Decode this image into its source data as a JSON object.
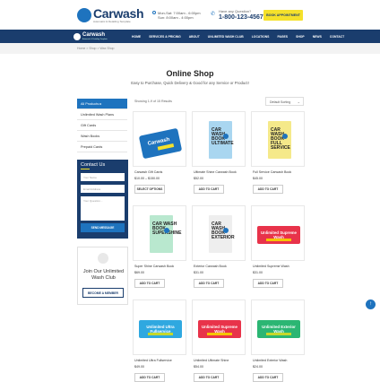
{
  "header": {
    "logo_word": "Carwash",
    "logo_tagline": "Automatic & Detailing Template",
    "hours_line1": "Mon-Sat: 7:00am - 6:00pm",
    "hours_line2": "Sun: 8:00am - 4:00pm",
    "phone_label": "Have any Question?",
    "phone": "1-800-123-4567",
    "book_button": "BOOK APPOINTMENT"
  },
  "nav": {
    "logo_word": "Carwash",
    "logo_tagline": "Automatic & Detailing Template",
    "items": [
      "HOME",
      "SERVICES & PRICING",
      "ABOUT",
      "UNLIMITED WASH CLUB",
      "LOCATIONS",
      "PAGES",
      "SHOP",
      "NEWS",
      "CONTACT"
    ]
  },
  "breadcrumb": "Home  >  Shop  >  Wax Shop",
  "page": {
    "title": "Online Shop",
    "subtitle": "Easy to Purchase, Quick Delivery & Good for any Service or Product!"
  },
  "sidebar": {
    "categories": [
      "All Products",
      "Unlimited Wash Plans",
      "Gift Cards",
      "Wash Books",
      "Prepaid Cards"
    ]
  },
  "contact": {
    "title": "Contact Us",
    "name_placeholder": "Your Name",
    "email_placeholder": "Email Address",
    "question_placeholder": "Your Question...",
    "send": "SEND MESSAGE"
  },
  "club": {
    "text": "Join Our Unlimited Wash Club",
    "button": "BECOME A MEMBER"
  },
  "shop": {
    "showing": "Showing 1-9 of 15 Results",
    "sort": "Default Sorting"
  },
  "products": [
    {
      "name": "Carwash Gift Cards",
      "price": "$10.00 – $150.00",
      "button": "SELECT OPTIONS",
      "kind": "gift",
      "card_text": "Carwash"
    },
    {
      "name": "Ultimate Shine Carwash Book",
      "price": "$52.00",
      "button": "ADD TO CART",
      "kind": "book",
      "color": "#a9d6f0",
      "book_text": "CAR WASH BOOK ULTIMATE"
    },
    {
      "name": "Full Service Carwash Book",
      "price": "$45.00",
      "button": "ADD TO CART",
      "kind": "book",
      "color": "#f5e98a",
      "book_text": "CAR WASH BOOK FULL SERVICE"
    },
    {
      "name": "Super Shine Carwash Book",
      "price": "$69.00",
      "button": "ADD TO CART",
      "kind": "book",
      "color": "#b9e8cf",
      "book_text": "CAR WASH BOOK SUPERSHINE"
    },
    {
      "name": "Exterior Carwash Book",
      "price": "$31.00",
      "button": "ADD TO CART",
      "kind": "book",
      "color": "#eeeeee",
      "book_text": "CAR WASH BOOK EXTERIOR"
    },
    {
      "name": "Unlimited Supreme Wash",
      "price": "$31.00",
      "button": "ADD TO CART",
      "kind": "label",
      "color": "#e8334a",
      "bar": "#f5c400",
      "label_text": "Unlimited Supreme Wash"
    },
    {
      "name": "Unlimited Ultra Fullservice",
      "price": "$49.00",
      "button": "ADD TO CART",
      "kind": "label",
      "color": "#2fa8e0",
      "bar": "#c6d82b",
      "label_text": "Unlimited Ultra Fullservice"
    },
    {
      "name": "Unlimited Ultimate Shine",
      "price": "$54.00",
      "button": "ADD TO CART",
      "kind": "label",
      "color": "#e8334a",
      "bar": "#f5c400",
      "label_text": "Unlimited Supreme Wash"
    },
    {
      "name": "Unlimited Exterior Wash",
      "price": "$24.00",
      "button": "ADD TO CART",
      "kind": "label",
      "color": "#2bb673",
      "bar": "#c6d82b",
      "label_text": "Unlimited Exterior Wash"
    }
  ],
  "fab_icon": "arrow-up-icon"
}
